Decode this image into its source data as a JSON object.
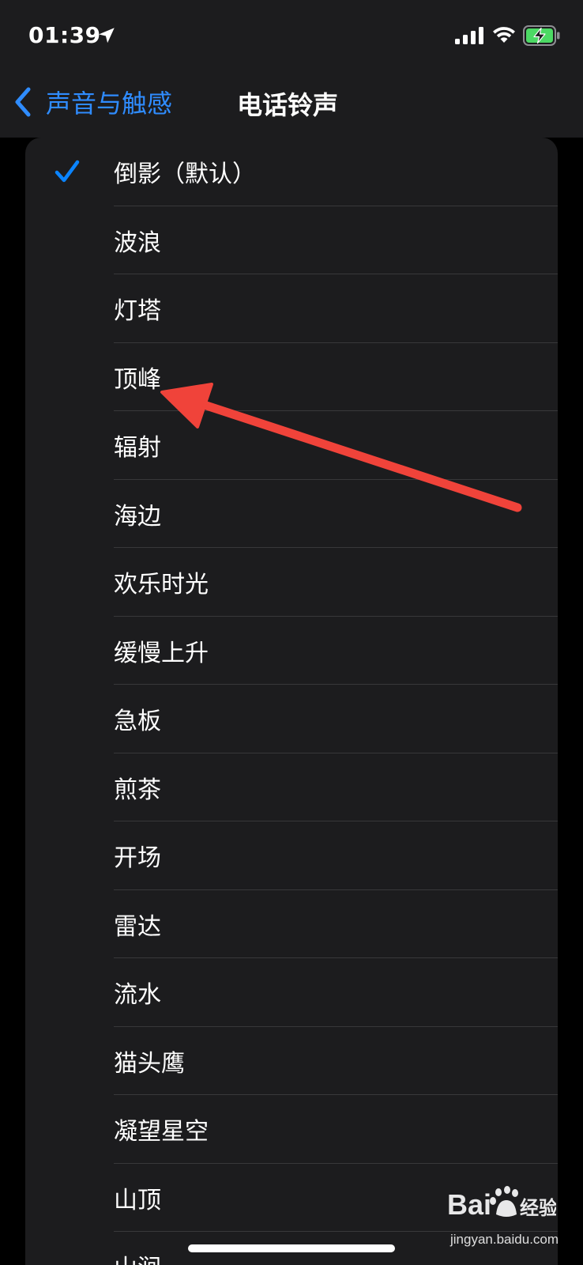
{
  "status_bar": {
    "time": "01:39",
    "icons": [
      "location-arrow-icon",
      "cellular-signal-icon",
      "wifi-icon",
      "battery-charging-icon"
    ],
    "battery_color": "#4cd964"
  },
  "nav": {
    "back_label": "声音与触感",
    "title": "电话铃声"
  },
  "ringtones": {
    "selected_index": 0,
    "items": [
      {
        "label": "倒影（默认）",
        "selected": true
      },
      {
        "label": "波浪",
        "selected": false
      },
      {
        "label": "灯塔",
        "selected": false
      },
      {
        "label": "顶峰",
        "selected": false
      },
      {
        "label": "辐射",
        "selected": false
      },
      {
        "label": "海边",
        "selected": false
      },
      {
        "label": "欢乐时光",
        "selected": false
      },
      {
        "label": "缓慢上升",
        "selected": false
      },
      {
        "label": "急板",
        "selected": false
      },
      {
        "label": "煎茶",
        "selected": false
      },
      {
        "label": "开场",
        "selected": false
      },
      {
        "label": "雷达",
        "selected": false
      },
      {
        "label": "流水",
        "selected": false
      },
      {
        "label": "猫头鹰",
        "selected": false
      },
      {
        "label": "凝望星空",
        "selected": false
      },
      {
        "label": "山顶",
        "selected": false
      },
      {
        "label": "山涧",
        "selected": false
      }
    ]
  },
  "colors": {
    "accent": "#0a84ff",
    "background": "#000000",
    "card": "#1c1c1e",
    "annotation_arrow": "#f0433a"
  },
  "annotation": {
    "type": "arrow",
    "points_to": "顶峰"
  },
  "watermark": {
    "logo_text": "Bai度经验",
    "url": "jingyan.baidu.com"
  }
}
